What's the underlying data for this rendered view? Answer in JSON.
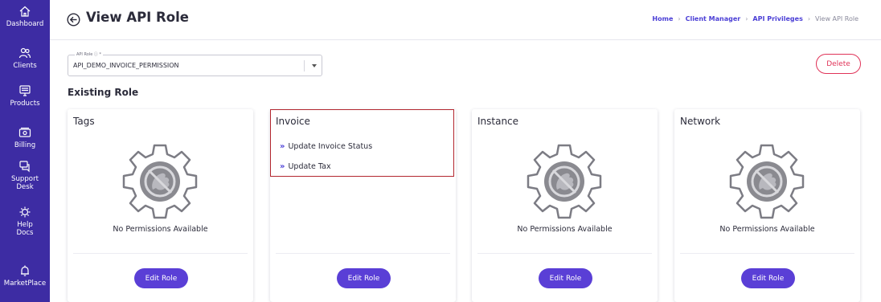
{
  "sidebar": {
    "items": [
      {
        "label": "Dashboard",
        "icon": "home-icon"
      },
      {
        "label": "Clients",
        "icon": "users-icon"
      },
      {
        "label": "Products",
        "icon": "monitor-icon"
      },
      {
        "label": "Billing",
        "icon": "billing-icon"
      },
      {
        "label": "Support Desk",
        "icon": "chat-icon"
      },
      {
        "label": "Help Docs",
        "icon": "gear-icon"
      },
      {
        "label": "MarketPlace",
        "icon": "bell-icon"
      }
    ]
  },
  "header": {
    "title": "View API Role",
    "breadcrumb": [
      "Home",
      "Client Manager",
      "API Privileges",
      "View API Role"
    ]
  },
  "form": {
    "api_role_label": "API Role ⓘ *",
    "api_role_value": "API_DEMO_INVOICE_PERMISSION",
    "delete_label": "Delete"
  },
  "existing_role_title": "Existing Role",
  "cards": [
    {
      "title": "Tags",
      "empty_text": "No Permissions Available",
      "permissions": [],
      "button": "Edit Role"
    },
    {
      "title": "Invoice",
      "empty_text": "",
      "permissions": [
        "Update Invoice Status",
        "Update Tax"
      ],
      "button": "Edit Role"
    },
    {
      "title": "Instance",
      "empty_text": "No Permissions Available",
      "permissions": [],
      "button": "Edit Role"
    },
    {
      "title": "Network",
      "empty_text": "No Permissions Available",
      "permissions": [],
      "button": "Edit Role"
    }
  ],
  "colors": {
    "sidebar": "#3d2ca3",
    "accent": "#5a3fd6",
    "danger": "#e03358",
    "highlight": "#b3262f"
  }
}
